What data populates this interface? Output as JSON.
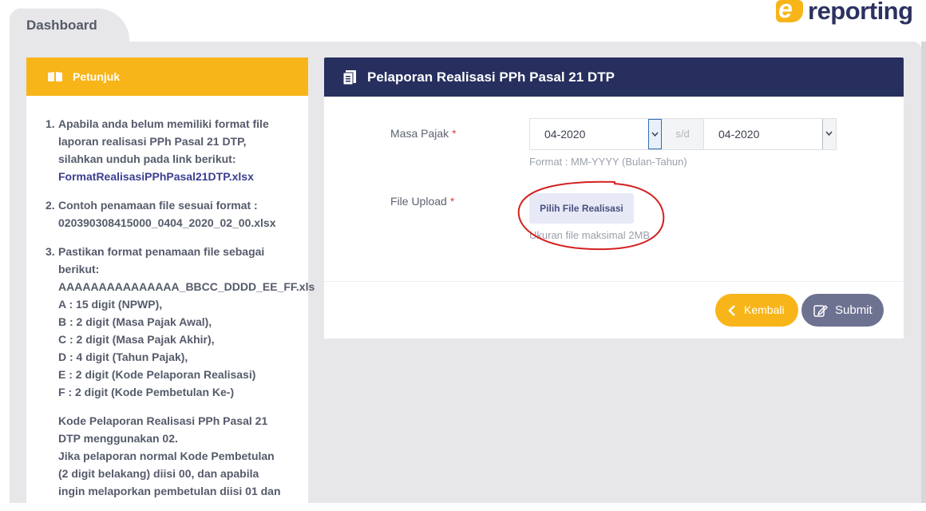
{
  "tab": {
    "label": "Dashboard"
  },
  "brand": {
    "letter": "e",
    "text": "reporting",
    "accent": "#f8b519",
    "dark": "#2b3160"
  },
  "instructions": {
    "title": "Petunjuk",
    "items": [
      {
        "num": "1.",
        "lines": [
          "Apabila anda belum memiliki format file",
          "laporan realisasi PPh Pasal 21 DTP,",
          "silahkan unduh pada link berikut:"
        ],
        "link": "FormatRealisasiPPhPasal21DTP.xlsx"
      },
      {
        "num": "2.",
        "lines": [
          "Contoh penamaan file sesuai format :",
          "020390308415000_0404_2020_02_00.xlsx"
        ]
      },
      {
        "num": "3.",
        "lines": [
          "Pastikan format penamaan file sebagai",
          "berikut:",
          "AAAAAAAAAAAAAAA_BBCC_DDDD_EE_FF.xls",
          "A : 15 digit (NPWP),",
          "B : 2 digit (Masa Pajak Awal),",
          "C : 2 digit (Masa Pajak Akhir),",
          "D : 4 digit (Tahun Pajak),",
          "E : 2 digit (Kode Pelaporan Realisasi)",
          "F : 2 digit (Kode Pembetulan Ke-)"
        ]
      }
    ],
    "note_lines": [
      "Kode Pelaporan Realisasi PPh Pasal 21",
      "DTP menggunakan 02.",
      "Jika pelaporan normal Kode Pembetulan",
      "(2 digit belakang) diisi 00, dan apabila",
      "ingin melaporkan pembetulan diisi 01 dan"
    ]
  },
  "form": {
    "title": "Pelaporan Realisasi PPh Pasal 21 DTP",
    "masa_pajak_label": "Masa Pajak",
    "required_mark": "*",
    "from_value": "04-2020",
    "separator": "s/d",
    "to_value": "04-2020",
    "format_hint": "Format : MM-YYYY (Bulan-Tahun)",
    "file_label": "File Upload",
    "file_button": "Pilih File Realisasi",
    "file_hint": "Ukuran file maksimal 2MB",
    "back_button": "Kembali",
    "submit_button": "Submit"
  }
}
